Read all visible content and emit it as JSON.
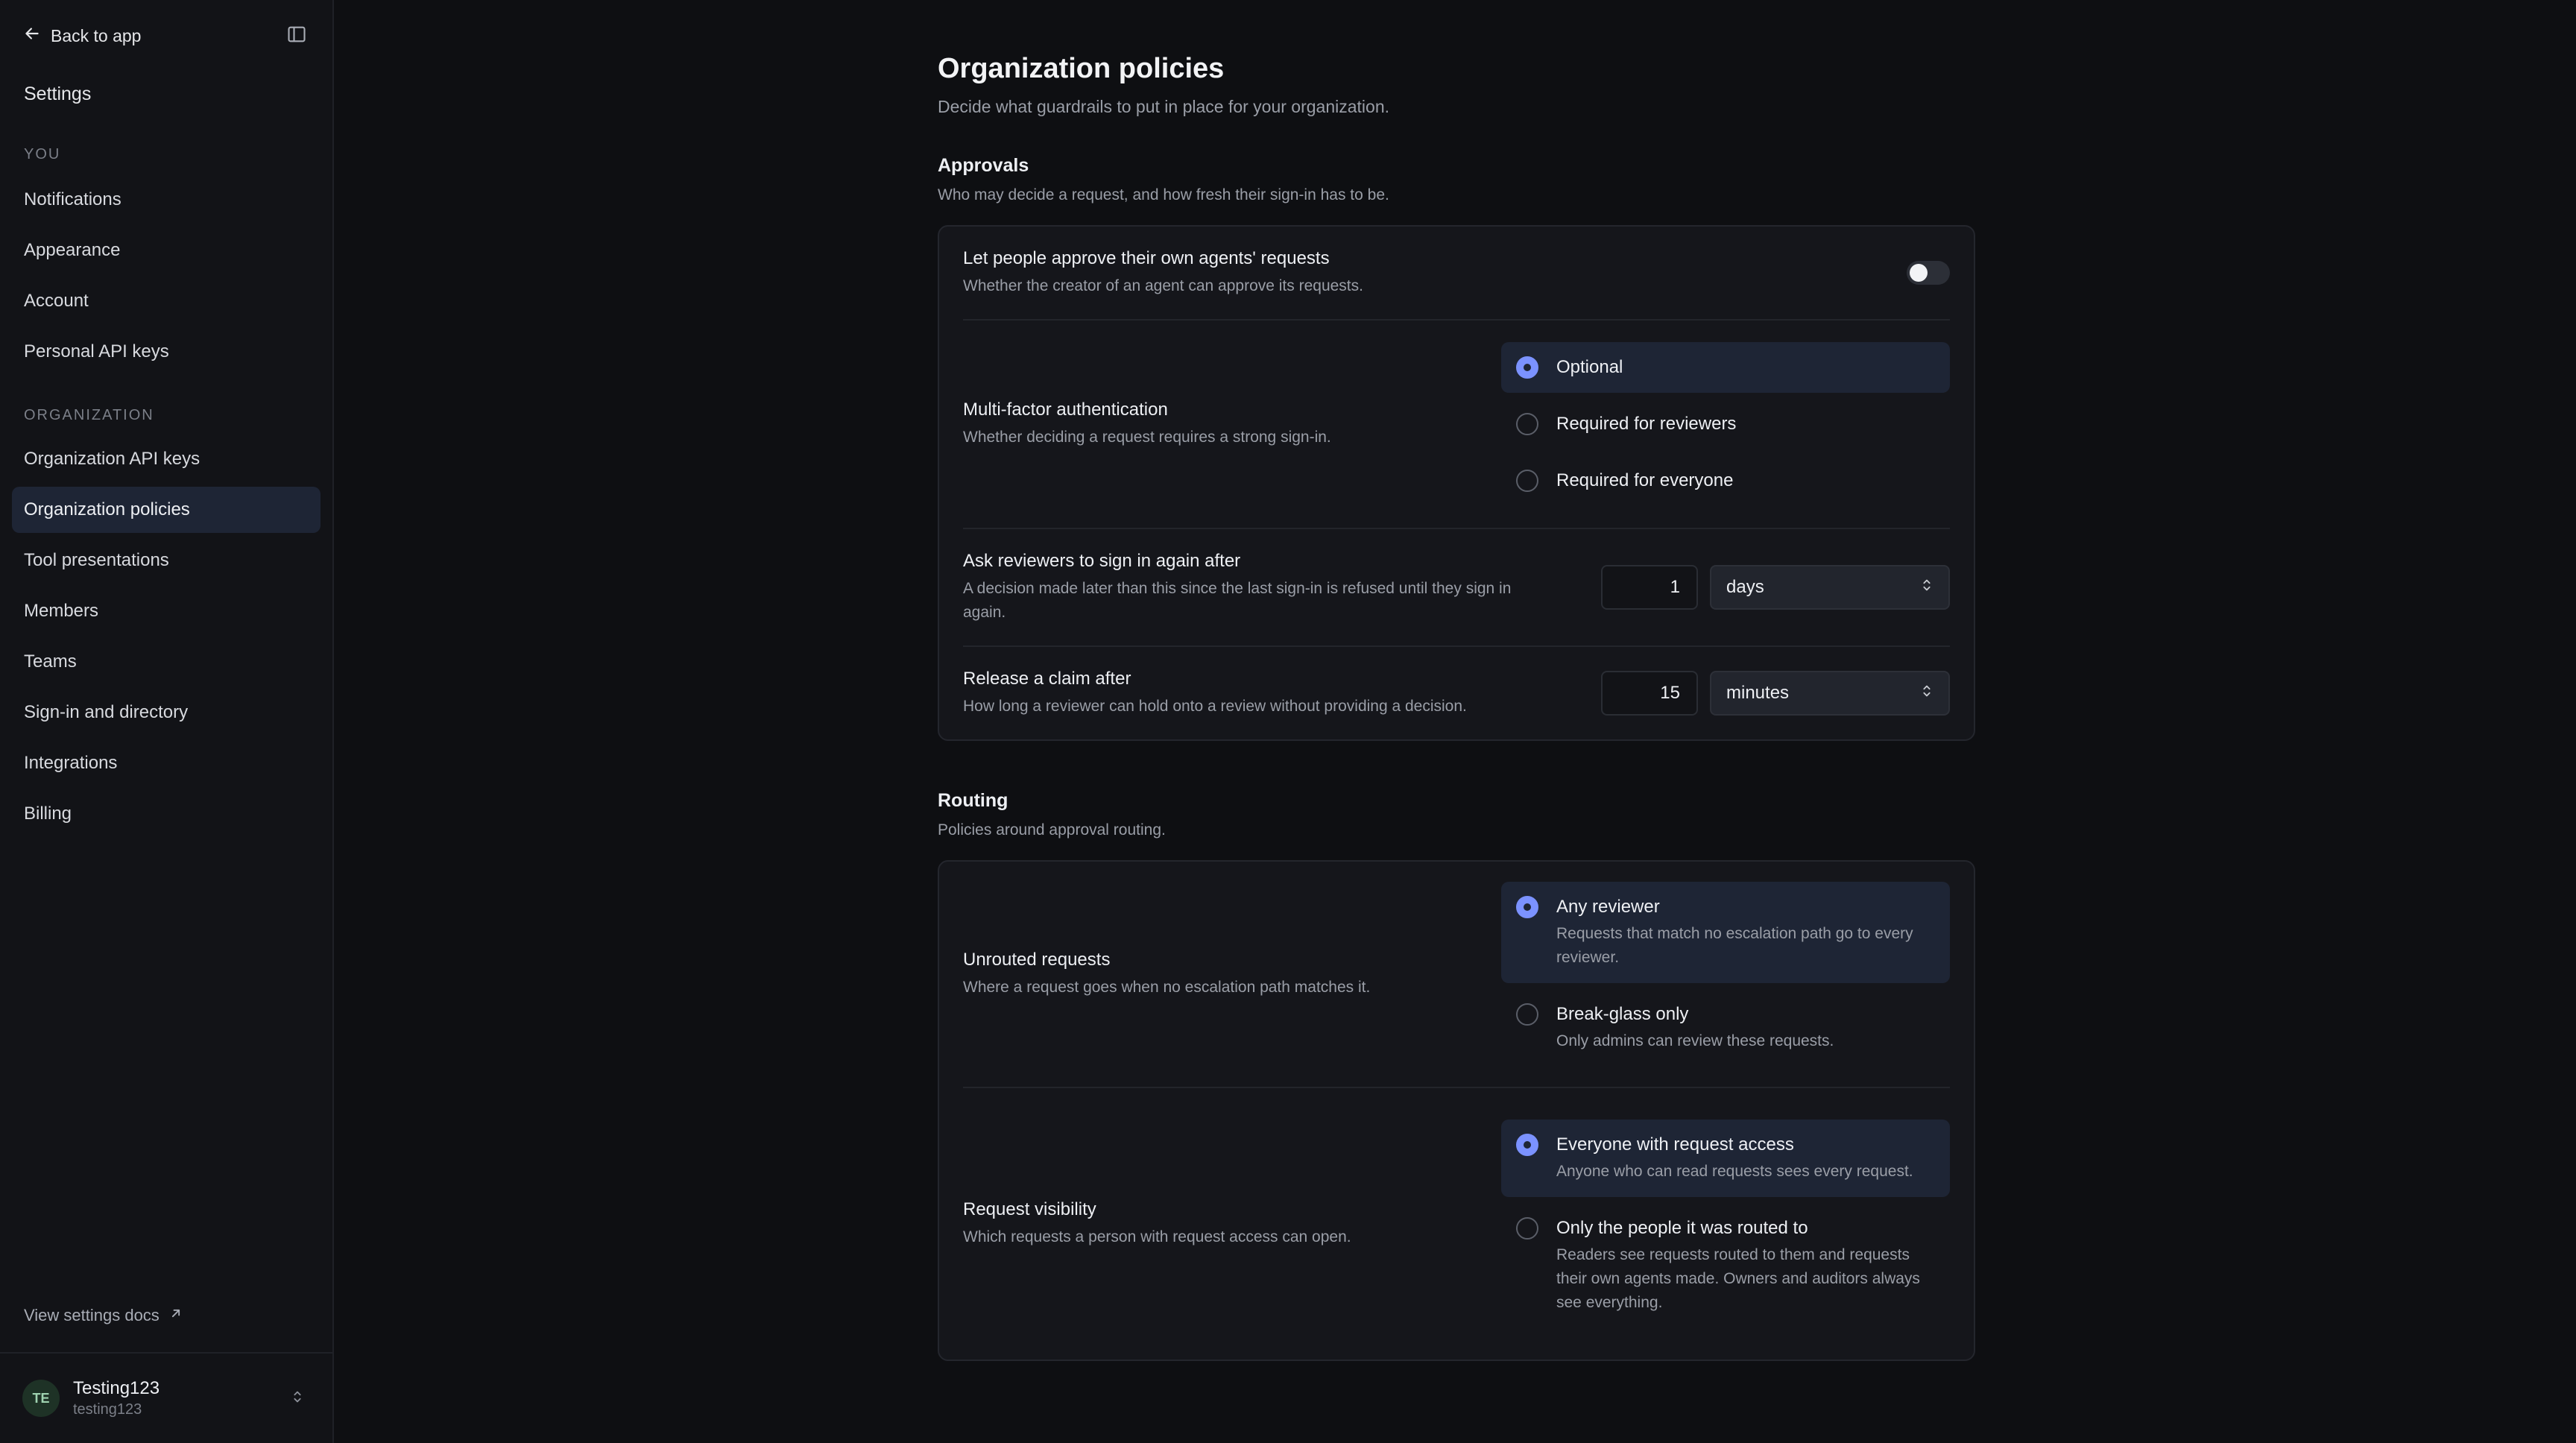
{
  "sidebar": {
    "back_label": "Back to app",
    "title": "Settings",
    "you_label": "YOU",
    "you_items": [
      {
        "label": "Notifications"
      },
      {
        "label": "Appearance"
      },
      {
        "label": "Account"
      },
      {
        "label": "Personal API keys"
      }
    ],
    "org_label": "ORGANIZATION",
    "org_items": [
      {
        "label": "Organization API keys"
      },
      {
        "label": "Organization policies",
        "active": true
      },
      {
        "label": "Tool presentations"
      },
      {
        "label": "Members"
      },
      {
        "label": "Teams"
      },
      {
        "label": "Sign-in and directory"
      },
      {
        "label": "Integrations"
      },
      {
        "label": "Billing"
      }
    ],
    "docs_label": "View settings docs",
    "user": {
      "initials": "TE",
      "name": "Testing123",
      "handle": "testing123"
    }
  },
  "page": {
    "title": "Organization policies",
    "subtitle": "Decide what guardrails to put in place for your organization."
  },
  "approvals": {
    "title": "Approvals",
    "desc": "Who may decide a request, and how fresh their sign-in has to be.",
    "self_approve": {
      "title": "Let people approve their own agents' requests",
      "desc": "Whether the creator of an agent can approve its requests.",
      "enabled": false
    },
    "mfa": {
      "title": "Multi-factor authentication",
      "desc": "Whether deciding a request requires a strong sign-in.",
      "options": [
        "Optional",
        "Required for reviewers",
        "Required for everyone"
      ],
      "selected": 0
    },
    "reauth": {
      "title": "Ask reviewers to sign in again after",
      "desc": "A decision made later than this since the last sign-in is refused until they sign in again.",
      "value": "1",
      "unit": "days"
    },
    "claim": {
      "title": "Release a claim after",
      "desc": "How long a reviewer can hold onto a review without providing a decision.",
      "value": "15",
      "unit": "minutes"
    }
  },
  "routing": {
    "title": "Routing",
    "desc": "Policies around approval routing.",
    "unrouted": {
      "title": "Unrouted requests",
      "desc": "Where a request goes when no escalation path matches it.",
      "options": [
        {
          "label": "Any reviewer",
          "desc": "Requests that match no escalation path go to every reviewer."
        },
        {
          "label": "Break-glass only",
          "desc": "Only admins can review these requests."
        }
      ],
      "selected": 0
    },
    "visibility": {
      "title": "Request visibility",
      "desc": "Which requests a person with request access can open.",
      "options": [
        {
          "label": "Everyone with request access",
          "desc": "Anyone who can read requests sees every request."
        },
        {
          "label": "Only the people it was routed to",
          "desc": "Readers see requests routed to them and requests their own agents made. Owners and auditors always see everything."
        }
      ],
      "selected": 0
    }
  }
}
